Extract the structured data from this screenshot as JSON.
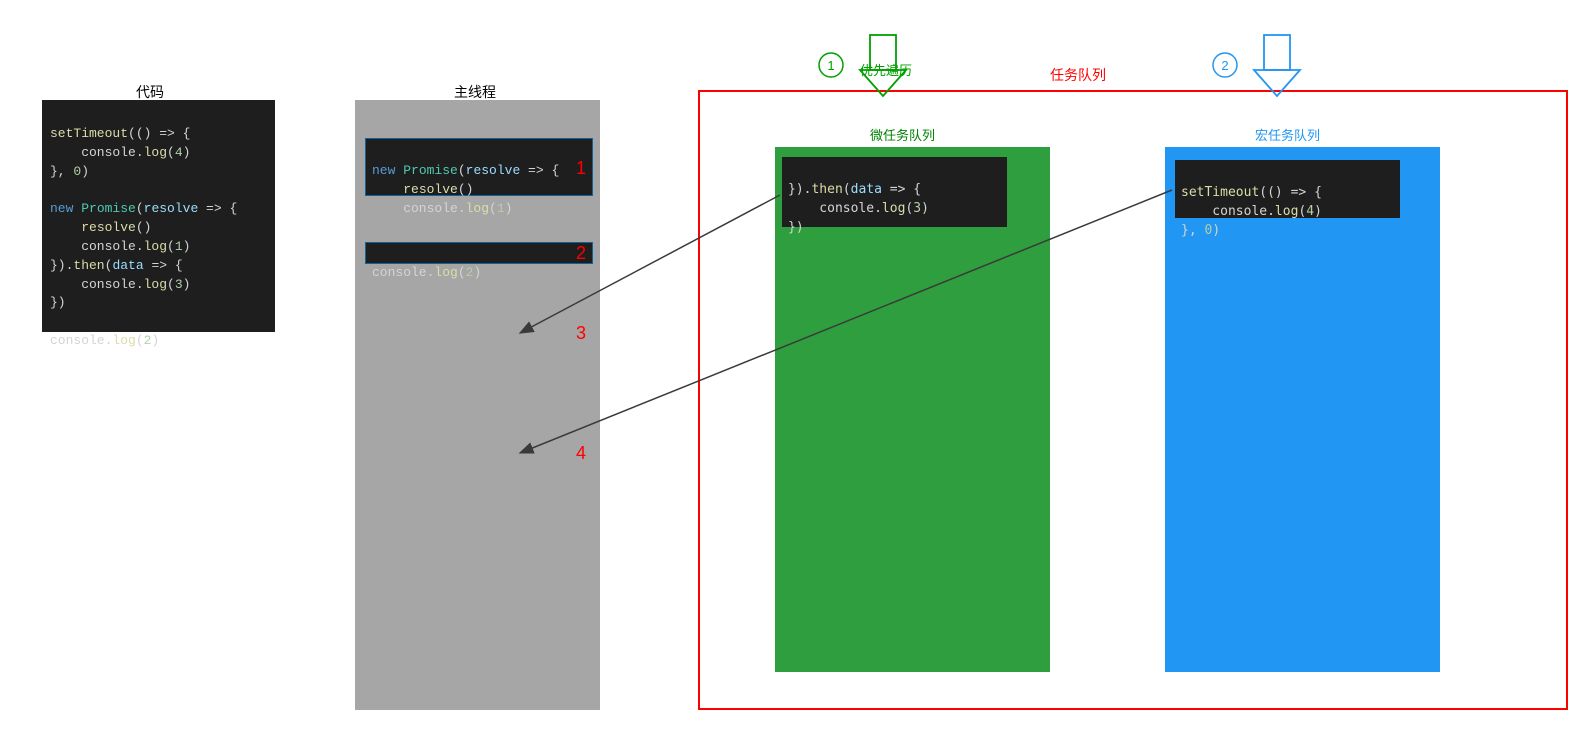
{
  "titles": {
    "code": "代码",
    "mainThread": "主线程",
    "taskQueue": "任务队列",
    "priority": "优先遍历",
    "microQueue": "微任务队列",
    "macroQueue": "宏任务队列"
  },
  "badge": {
    "one": "1",
    "two": "2"
  },
  "sourceCode": {
    "l1a": "setTimeout",
    "l1b": "(() => {",
    "l2a": "    console.",
    "l2b": "log",
    "l2c": "(",
    "l2d": "4",
    "l2e": ")",
    "l3": "}, ",
    "l3b": "0",
    "l3c": ")",
    "l4": "",
    "l5a": "new ",
    "l5b": "Promise",
    "l5c": "(",
    "l5d": "resolve",
    "l5e": " => {",
    "l6a": "    ",
    "l6b": "resolve",
    "l6c": "()",
    "l7a": "    console.",
    "l7b": "log",
    "l7c": "(",
    "l7d": "1",
    "l7e": ")",
    "l8a": "}).",
    "l8b": "then",
    "l8c": "(",
    "l8d": "data",
    "l8e": " => {",
    "l9a": "    console.",
    "l9b": "log",
    "l9c": "(",
    "l9d": "3",
    "l9e": ")",
    "l10": "})",
    "l11": "",
    "l12a": "console.",
    "l12b": "log",
    "l12c": "(",
    "l12d": "2",
    "l12e": ")"
  },
  "thread": {
    "item1_l1a": "new ",
    "item1_l1b": "Promise",
    "item1_l1c": "(",
    "item1_l1d": "resolve",
    "item1_l1e": " => {",
    "item1_l2a": "    ",
    "item1_l2b": "resolve",
    "item1_l2c": "()",
    "item1_l3a": "    console.",
    "item1_l3b": "log",
    "item1_l3c": "(",
    "item1_l3d": "1",
    "item1_l3e": ")",
    "item2a": "console.",
    "item2b": "log",
    "item2c": "(",
    "item2d": "2",
    "item2e": ")",
    "step1": "1",
    "step2": "2",
    "step3": "3",
    "step4": "4"
  },
  "micro": {
    "l0": "",
    "l1a": "}).",
    "l1b": "then",
    "l1c": "(",
    "l1d": "data",
    "l1e": " => {",
    "l2a": "    console.",
    "l2b": "log",
    "l2c": "(",
    "l2d": "3",
    "l2e": ")",
    "l3": "})"
  },
  "macro": {
    "l1a": "setTimeout",
    "l1b": "(() => {",
    "l2a": "    console.",
    "l2b": "log",
    "l2c": "(",
    "l2d": "4",
    "l2e": ")",
    "l3a": "}, ",
    "l3b": "0",
    "l3c": ")"
  },
  "colors": {
    "red": "#ff0000",
    "green": "#2e9e3f",
    "blue": "#2196f3",
    "darkGreen": "#008000",
    "brightGreen": "#00a000"
  }
}
